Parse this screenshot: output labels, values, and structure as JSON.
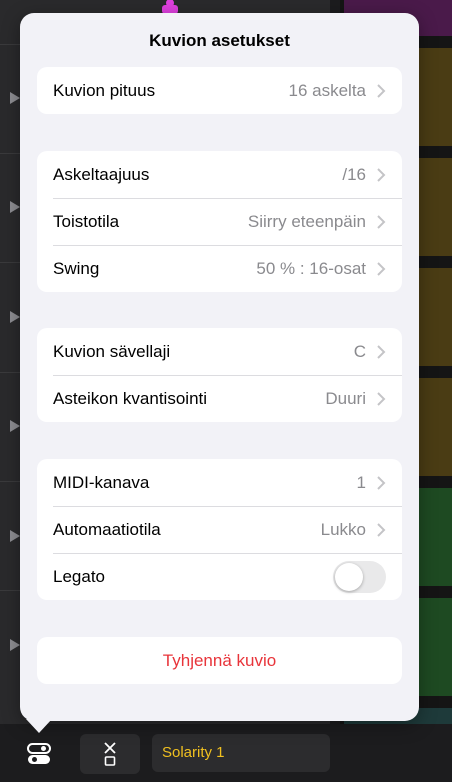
{
  "popover": {
    "title": "Kuvion asetukset",
    "groups": [
      [
        {
          "label": "Kuvion pituus",
          "value": "16 askelta"
        }
      ],
      [
        {
          "label": "Askeltaajuus",
          "value": "/16"
        },
        {
          "label": "Toistotila",
          "value": "Siirry eteenpäin"
        },
        {
          "label": "Swing",
          "value": "50 % : 16-osat"
        }
      ],
      [
        {
          "label": "Kuvion sävellaji",
          "value": "C"
        },
        {
          "label": "Asteikon kvantisointi",
          "value": "Duuri"
        }
      ],
      [
        {
          "label": "MIDI-kanava",
          "value": "1"
        },
        {
          "label": "Automaatiotila",
          "value": "Lukko"
        },
        {
          "label": "Legato",
          "toggle_on": false
        }
      ]
    ],
    "clear_button": "Tyhjennä kuvio"
  },
  "bottom_bar": {
    "instrument_name": "Solarity 1",
    "icons": [
      "settings-toggle-icon",
      "grid-close-icon"
    ]
  },
  "colors": {
    "accent_destructive": "#e8343a",
    "instrument_name": "#f0c020",
    "pad_cells": [
      "#2a5a2a",
      "#5a4a1a",
      "#4a1a4a"
    ]
  }
}
